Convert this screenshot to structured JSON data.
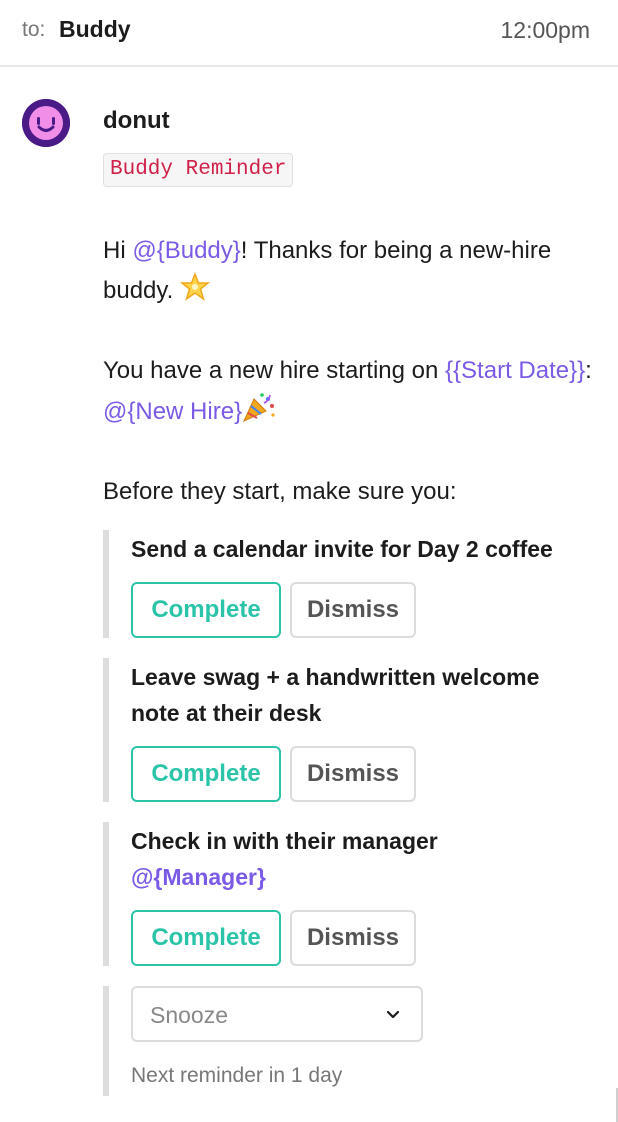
{
  "header": {
    "to_label": "to:",
    "recipient": "Buddy",
    "time": "12:00pm"
  },
  "message": {
    "sender": "donut",
    "tag": "Buddy Reminder",
    "intro": {
      "pre": "Hi ",
      "buddy_var": "@{Buddy}",
      "post": "! Thanks for being a new-hire buddy. ",
      "emoji": "glowing-star-icon"
    },
    "start": {
      "pre": "You have a new hire starting on ",
      "date_var": "{{Start Date}}",
      "mid": ": ",
      "hire_var": "@{New Hire}",
      "emoji": "party-popper-icon"
    },
    "before": "Before they start, make sure you:",
    "tasks": [
      {
        "title": "Send a calendar invite for Day 2 coffee",
        "complete_label": "Complete",
        "dismiss_label": "Dismiss"
      },
      {
        "title": "Leave swag + a handwritten welcome note at their desk",
        "complete_label": "Complete",
        "dismiss_label": "Dismiss"
      },
      {
        "title": "Check in with their manager ",
        "title_var": "@{Manager}",
        "complete_label": "Complete",
        "dismiss_label": "Dismiss"
      }
    ],
    "snooze": {
      "label": "Snooze",
      "icon": "chevron-down-icon",
      "next_reminder": "Next reminder in 1 day"
    }
  },
  "colors": {
    "accent_complete": "#2bc4a9",
    "variable": "#7b5be6",
    "tag_text": "#d0214a",
    "avatar": "#4a1a86"
  }
}
